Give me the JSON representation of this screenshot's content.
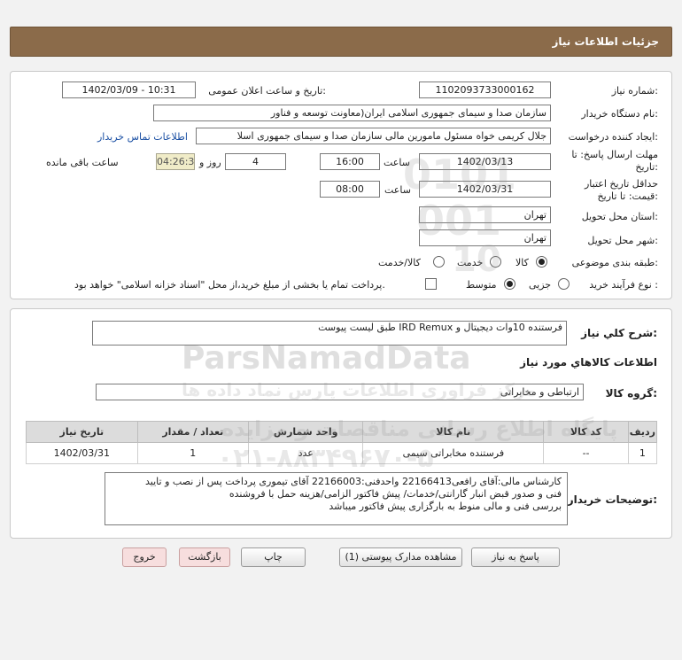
{
  "header": {
    "title": "جزئیات اطلاعات نیاز"
  },
  "form": {
    "need_number_label": "شماره نیاز:",
    "need_number": "1102093733000162",
    "announce_label": "تاریخ و ساعت اعلان عمومی:",
    "announce_value": "1402/03/09 - 10:31",
    "buyer_org_label": "نام دستگاه خریدار:",
    "buyer_org": "سازمان صدا و سیمای جمهوری اسلامی ایران(معاونت توسعه و فناور",
    "creator_label": "ایجاد کننده درخواست:",
    "creator": "جلال کریمی خواه مسئول مامورین مالی  سازمان صدا و سیمای جمهوری اسلا",
    "contact_link": "اطلاعات تماس خریدار",
    "deadline_label_1": "مهلت ارسال پاسخ: تا",
    "deadline_label_2": "تاریخ:",
    "deadline_date": "1402/03/13",
    "time_label": "ساعت",
    "deadline_time": "16:00",
    "days_value": "4",
    "days_label": "روز و",
    "remaining_time": "04:26:39",
    "remaining_label": "ساعت باقی مانده",
    "validity_label_1": "حداقل تاریخ اعتبار",
    "validity_label_2": "قیمت: تا تاریخ:",
    "validity_date": "1402/03/31",
    "validity_time_label": "ساعت",
    "validity_time": "08:00",
    "province_label": "استان محل تحویل:",
    "province": "تهران",
    "city_label": "شهر محل تحویل:",
    "city": "تهران",
    "category_label": "طبقه بندی موضوعی:",
    "category_options": [
      "کالا",
      "خدمت",
      "کالا/خدمت"
    ],
    "process_label": "نوع فرآیند خرید :",
    "process_options": [
      "جزیی",
      "متوسط"
    ],
    "payment_text": "پرداخت تمام یا بخشی از مبلغ خرید،از محل \"اسناد خزانه اسلامی\" خواهد بود."
  },
  "summary": {
    "label": "شرح کلي نياز:",
    "value": "فرستنده 10وات دیجیتال و IRD Remux طبق لیست پیوست"
  },
  "goods": {
    "section_title": "اطلاعات کالاهاي مورد نياز",
    "group_label": "گروه کالا:",
    "group_value": "ارتباطی و مخابراتی",
    "columns": [
      "ردیف",
      "کد کالا",
      "نام کالا",
      "واحد شمارش",
      "تعداد / مقدار",
      "تاریخ نیاز"
    ],
    "rows": [
      [
        "1",
        "--",
        "فرستنده مخابراتی سیمی",
        "عدد",
        "1",
        "1402/03/31"
      ]
    ]
  },
  "buyer_notes": {
    "label": "توضیحات خریدار:",
    "lines": [
      "کارشناس مالی:آقای رافعی22166413  واحدفنی:22166003 آقای تیموری  پرداخت پس از  نصب و تایید",
      "فنی و صدور قبض انبار گارانتی/خدمات/ پیش فاکتور الزامی/هزینه حمل با فروشنده",
      "بررسی فنی و مالی منوط به بارگزاری پیش فاکتور میباشد"
    ]
  },
  "buttons": {
    "reply": "پاسخ به نیاز",
    "attachments": "مشاهده مدارک پیوستی (1)",
    "print": "چاپ",
    "back": "بازگشت",
    "exit": "خروج"
  },
  "watermark": {
    "brand": "ParsNamadData",
    "persian_1": "مرکز فراوری اطلاعات پارس نماد داده ها",
    "persian_2": "پایگاه اطلاع رسانی مناقصات و مزایده",
    "phone": "۰۲۱-۸۸۳۴۹۶۷۰-۵",
    "code_1": "0101",
    "code_2": "001",
    "code_3": "10"
  }
}
